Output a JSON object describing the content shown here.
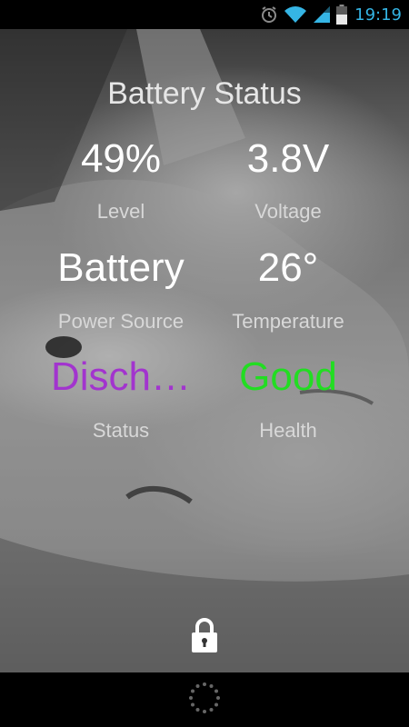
{
  "status_bar": {
    "time": "19:19",
    "icons": [
      "alarm-icon",
      "wifi-icon",
      "signal-icon",
      "battery-icon"
    ],
    "accent_color": "#35b5e5"
  },
  "app": {
    "title": "Battery Status",
    "metrics": {
      "level": {
        "value": "49%",
        "label": "Level"
      },
      "voltage": {
        "value": "3.8V",
        "label": "Voltage"
      },
      "power_source": {
        "value": "Battery",
        "label": "Power Source"
      },
      "temperature": {
        "value": "26°",
        "label": "Temperature"
      },
      "status": {
        "value": "Disch…",
        "label": "Status",
        "color": "#a234ce"
      },
      "health": {
        "value": "Good",
        "label": "Health",
        "color": "#22dd22"
      }
    }
  },
  "lockscreen": {
    "lock_icon": "padlock-icon",
    "nav_icon": "dotted-circle-icon"
  }
}
